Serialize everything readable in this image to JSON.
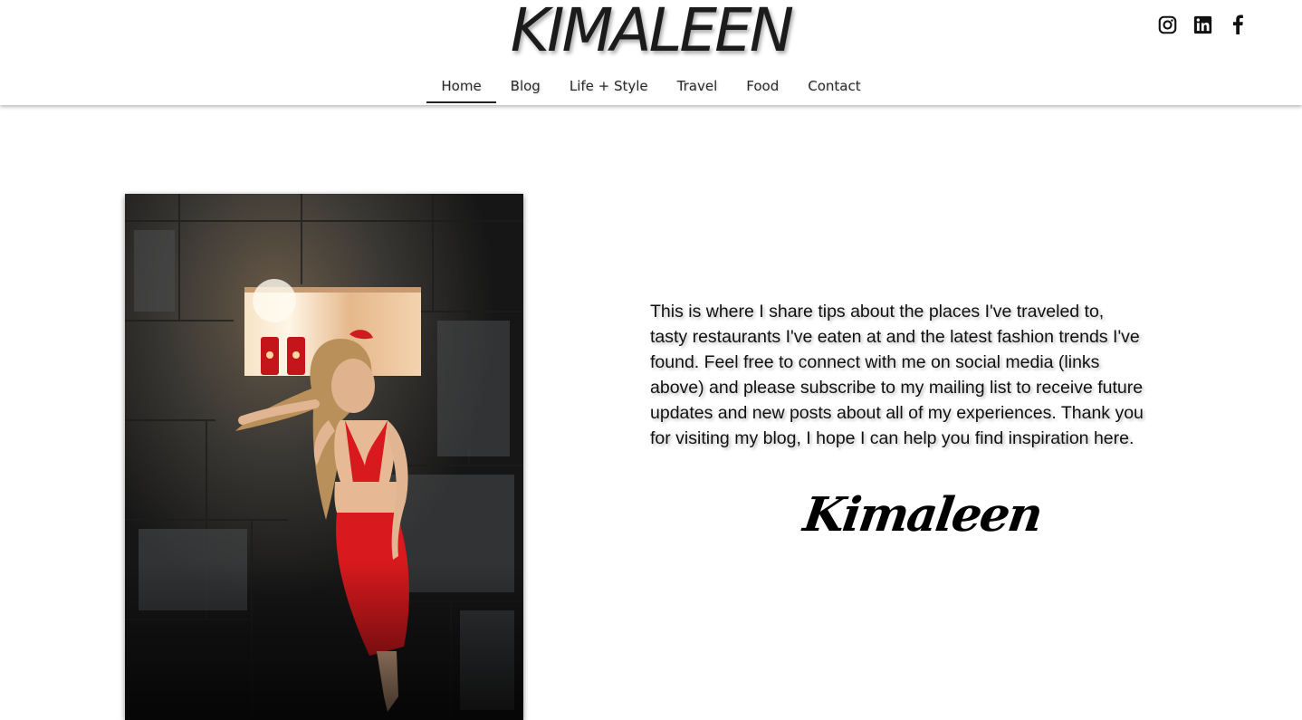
{
  "site": {
    "logo": "KIMALEEN"
  },
  "social": [
    {
      "name": "instagram-icon"
    },
    {
      "name": "linkedin-icon"
    },
    {
      "name": "facebook-icon"
    }
  ],
  "nav": {
    "items": [
      {
        "label": "Home",
        "active": true
      },
      {
        "label": "Blog"
      },
      {
        "label": "Life + Style"
      },
      {
        "label": "Travel"
      },
      {
        "label": "Food"
      },
      {
        "label": "Contact"
      }
    ]
  },
  "main": {
    "intro": "This is where I share tips about the places I've traveled to, tasty restaurants I've eaten at and the latest fashion trends I've found. Feel free to connect with me on social media (links above) and please subscribe to my mailing list to receive future updates and new posts about all of my experiences. Thank you for visiting my blog, I hope I can help you find inspiration here.",
    "signature": "Kimaleen"
  },
  "colors": {
    "text": "#111111",
    "background": "#ffffff",
    "dress": "#d8191d"
  }
}
